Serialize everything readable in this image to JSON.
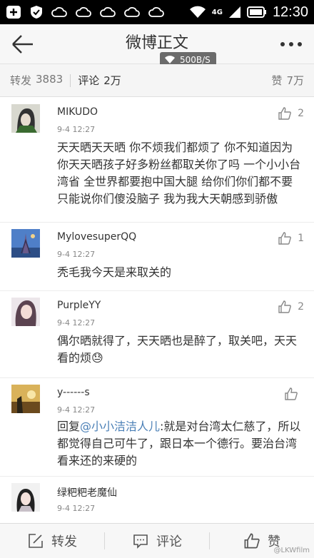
{
  "status_bar": {
    "time": "12:30",
    "network": "4G",
    "icons": [
      "plus-square-icon",
      "shield-check-icon",
      "cloud-icon",
      "cloud-icon",
      "cloud-icon",
      "cloud-icon",
      "cloud-icon",
      "wifi-icon",
      "signal-icon",
      "battery-icon"
    ]
  },
  "header": {
    "title": "微博正文",
    "speed": "500B/S"
  },
  "tabs": {
    "repost_label": "转发",
    "repost_count": "3883",
    "comment_label": "评论",
    "comment_count": "2万",
    "like_label": "赞",
    "like_count": "7万"
  },
  "comments": [
    {
      "name": "MIKUDO",
      "time": "9-4 12:27",
      "likes": "2",
      "text": "天天晒天天晒 你不烦我们都烦了 你不知道因为你天天晒孩子好多粉丝都取关你了吗 一个小小台湾省 全世界都要抱中国大腿 给你们你们都不要 只能说你们傻没脑子 我为我大天朝感到骄傲"
    },
    {
      "name": "MylovesuperQQ",
      "time": "9-4 12:27",
      "likes": "1",
      "text": "秃毛我今天是来取关的"
    },
    {
      "name": "PurpleYY",
      "time": "9-4 12:27",
      "likes": "2",
      "text": "偶尔晒就得了，天天晒也是醉了，取关吧，天天看的烦",
      "emoji": "😓"
    },
    {
      "name": "y------s",
      "time": "9-4 12:27",
      "likes": "",
      "reply_prefix": "回复",
      "mention": "@小小洁洁人儿",
      "text": ":就是对台湾太仁慈了，所以都觉得自己可牛了，跟日本一个德行。要治台湾看来还的来硬的"
    },
    {
      "name": "绿粑粑老魔仙",
      "time": "9-4 12:27",
      "likes": "",
      "text": ""
    }
  ],
  "bottom_bar": {
    "repost_label": "转发",
    "comment_label": "评论",
    "like_label": "赞",
    "watermark": "@LKWfilm"
  },
  "colors": {
    "status_bar": "#000000",
    "header_bg": "#f7f7f7",
    "mention": "#4a7fb6",
    "text": "#333333"
  }
}
